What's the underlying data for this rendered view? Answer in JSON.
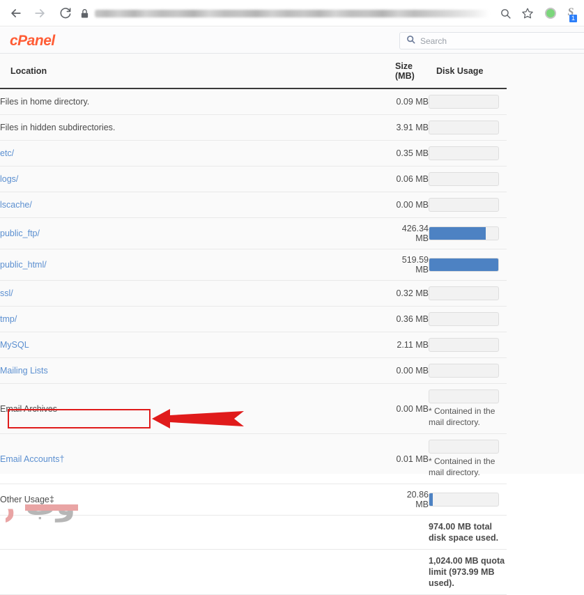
{
  "browser": {
    "back_icon": "arrow-left-icon",
    "forward_icon": "arrow-right-icon",
    "reload_icon": "reload-icon",
    "lock_icon": "lock-icon",
    "url_text": "",
    "zoom_icon": "zoom-search-icon",
    "bookmark_icon": "star-icon",
    "profile_icon": "profile-avatar-icon",
    "extension_letter": "S",
    "extension_badge": "1"
  },
  "cpanel": {
    "logo_text": "cPanel",
    "search_placeholder": "Search",
    "search_value": "",
    "search_icon": "search-icon"
  },
  "table": {
    "headers": {
      "location": "Location",
      "size_line1": "Size",
      "size_line2": "(MB)",
      "disk_usage": "Disk Usage"
    },
    "rows": [
      {
        "location": "Files in home directory.",
        "link": false,
        "size": "0.09 MB",
        "percent": 0,
        "note": ""
      },
      {
        "location": "Files in hidden subdirectories.",
        "link": false,
        "size": "3.91 MB",
        "percent": 0,
        "note": ""
      },
      {
        "location": "etc/",
        "link": true,
        "size": "0.35 MB",
        "percent": 0,
        "note": ""
      },
      {
        "location": "logs/",
        "link": true,
        "size": "0.06 MB",
        "percent": 0,
        "note": ""
      },
      {
        "location": "lscache/",
        "link": true,
        "size": "0.00 MB",
        "percent": 0,
        "note": ""
      },
      {
        "location": "public_ftp/",
        "link": true,
        "size": "426.34 MB",
        "percent": 82,
        "note": ""
      },
      {
        "location": "public_html/",
        "link": true,
        "size": "519.59 MB",
        "percent": 100,
        "note": ""
      },
      {
        "location": "ssl/",
        "link": true,
        "size": "0.32 MB",
        "percent": 0,
        "note": ""
      },
      {
        "location": "tmp/",
        "link": true,
        "size": "0.36 MB",
        "percent": 0,
        "note": ""
      },
      {
        "location": "MySQL",
        "link": true,
        "size": "2.11 MB",
        "percent": 0,
        "note": ""
      },
      {
        "location": "Mailing Lists",
        "link": true,
        "size": "0.00 MB",
        "percent": 0,
        "note": ""
      },
      {
        "location": "Email Archives",
        "link": false,
        "size": "0.00 MB",
        "percent": 0,
        "note": "* Contained in the mail directory."
      },
      {
        "location": "Email Accounts†",
        "link": true,
        "size": "0.01 MB",
        "percent": 0,
        "note": "* Contained in the mail directory."
      },
      {
        "location": "Other Usage‡",
        "link": false,
        "size": "20.86 MB",
        "percent": 5,
        "note": ""
      }
    ],
    "totals": [
      {
        "text": "974.00 MB total disk space used."
      },
      {
        "text": "1,024.00 MB quota limit (973.99 MB used)."
      }
    ]
  },
  "annotation": {
    "highlight_target": "Email Accounts†",
    "box_color": "#e01b1b",
    "arrow_color": "#e01b1b"
  },
  "watermark": {
    "text_gray": "وب",
    "text_pink": "رمز",
    "color_gray": "#b3b3b3",
    "color_pink": "#e8a0a0"
  },
  "colors": {
    "brand": "#ff5c35",
    "bar_fill": "#4d82c3",
    "link": "#5b8fd0",
    "page_bg": "#fafafa"
  }
}
